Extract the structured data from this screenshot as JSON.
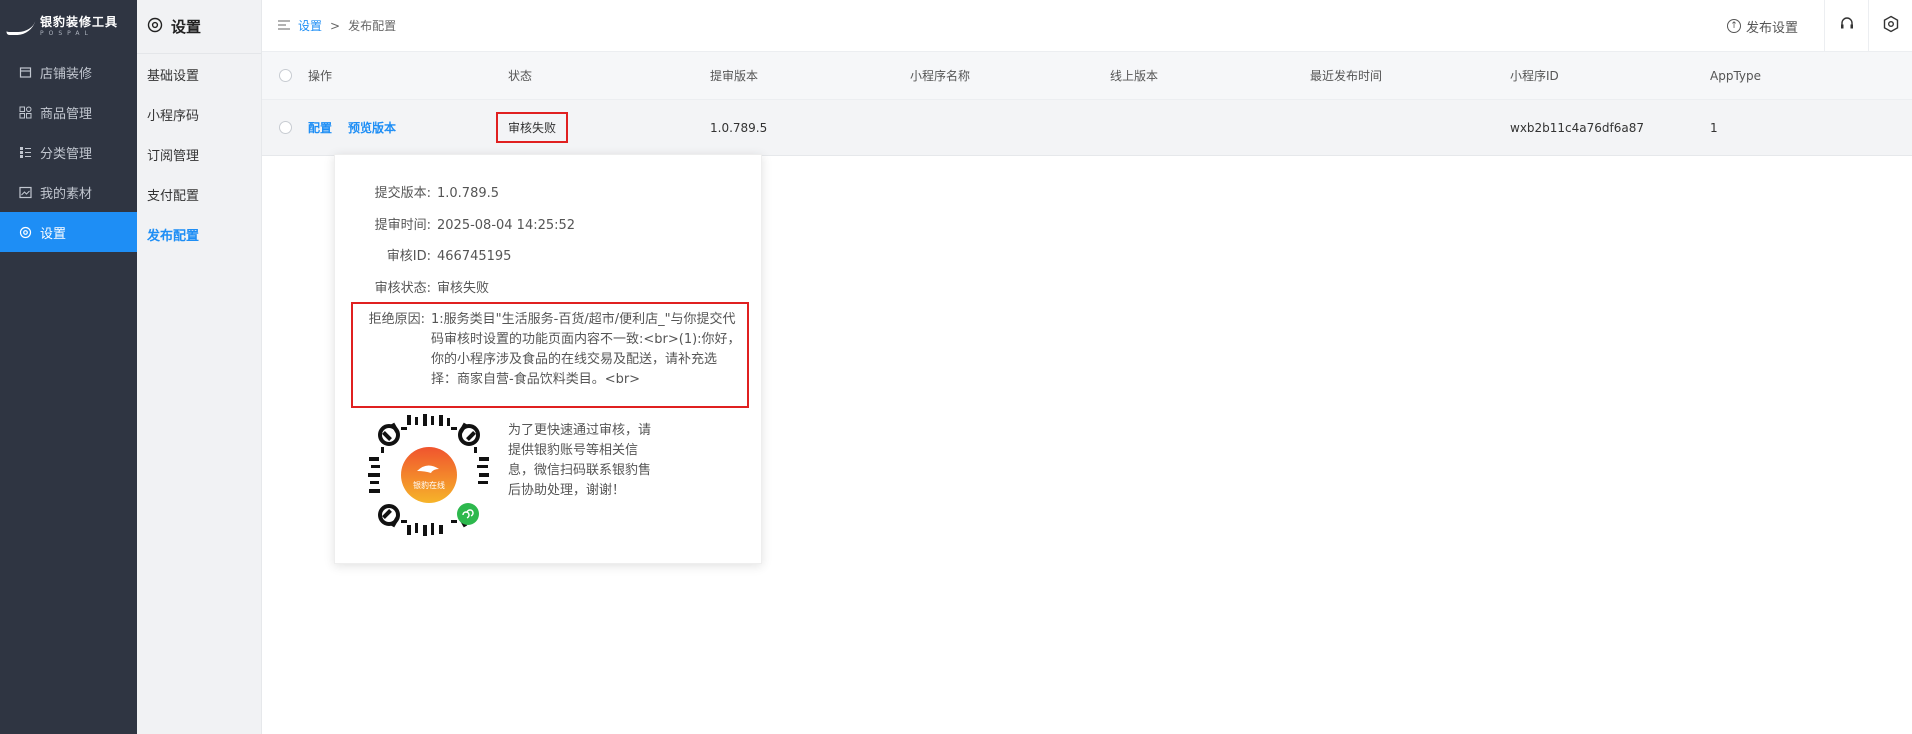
{
  "sidebar": {
    "logo": {
      "title": "银豹装修工具",
      "subtitle": "POSPAL"
    },
    "items": [
      {
        "label": "店铺装修",
        "icon": "store-icon",
        "active": false
      },
      {
        "label": "商品管理",
        "icon": "grid-icon",
        "active": false
      },
      {
        "label": "分类管理",
        "icon": "list-icon",
        "active": false
      },
      {
        "label": "我的素材",
        "icon": "image-icon",
        "active": false
      },
      {
        "label": "设置",
        "icon": "gear-icon",
        "active": true
      }
    ]
  },
  "submenu": {
    "title": "设置",
    "items": [
      {
        "label": "基础设置",
        "active": false
      },
      {
        "label": "小程序码",
        "active": false
      },
      {
        "label": "订阅管理",
        "active": false
      },
      {
        "label": "支付配置",
        "active": false
      },
      {
        "label": "发布配置",
        "active": true
      }
    ]
  },
  "topbar": {
    "breadcrumb": {
      "root": "设置",
      "separator": ">",
      "current": "发布配置"
    },
    "publish_settings_label": "发布设置"
  },
  "table": {
    "headers": [
      "操作",
      "状态",
      "提审版本",
      "小程序名称",
      "线上版本",
      "最近发布时间",
      "小程序ID",
      "AppType"
    ],
    "rows": [
      {
        "op_config": "配置",
        "op_preview": "预览版本",
        "status": "审核失败",
        "audit_version": "1.0.789.5",
        "app_name": "",
        "online_version": "",
        "last_publish": "",
        "app_id": "wxb2b11c4a76df6a87",
        "app_type": "1"
      }
    ]
  },
  "popover": {
    "rows": [
      {
        "key": "提交版本:",
        "value": "1.0.789.5"
      },
      {
        "key": "提审时间:",
        "value": "2025-08-04 14:25:52"
      },
      {
        "key": "审核ID:",
        "value": "466745195"
      },
      {
        "key": "审核状态:",
        "value": "审核失败"
      }
    ],
    "reason_key": "拒绝原因:",
    "reason_text": "1:服务类目\"生活服务-百货/超市/便利店_\"与你提交代码审核时设置的功能页面内容不一致:<br>(1):你好，你的小程序涉及食品的在线交易及配送，请补充选择：商家自营-食品饮料类目。<br>",
    "help_text": "为了更快速通过审核，请提供银豹账号等相关信息，微信扫码联系银豹售后协助处理，谢谢！",
    "qr_center_label": "银豹在线"
  },
  "colors": {
    "accent": "#1e8ef5",
    "sidebar_bg": "#2f3542",
    "highlight": "#e02020"
  }
}
